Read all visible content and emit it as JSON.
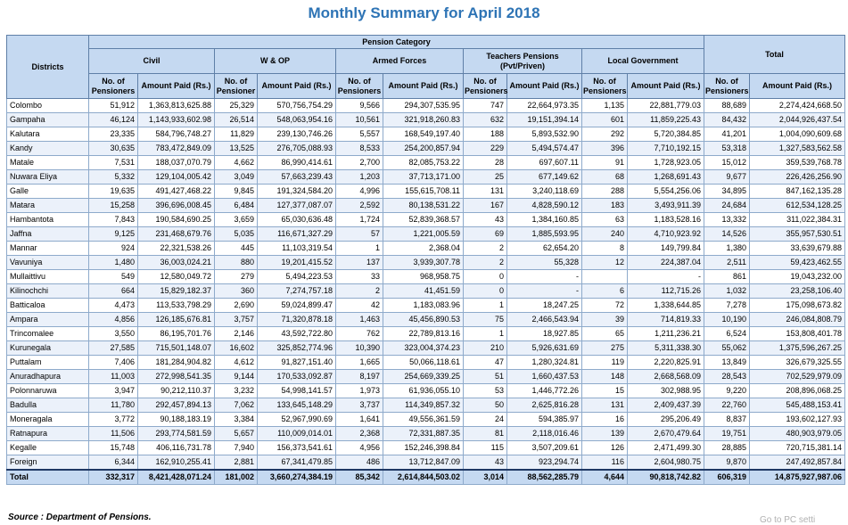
{
  "title": "Monthly Summary for  April 2018",
  "headers": {
    "districts": "Districts",
    "pension_category": "Pension Category",
    "total": "Total",
    "civil": "Civil",
    "wop": "W & OP",
    "armed": "Armed Forces",
    "teachers": "Teachers Pensions (Pvt/Priven)",
    "local": "Local Government",
    "civil_no": "No. of Pensioners",
    "civil_amt": "Amount Paid (Rs.)",
    "wop_no": "No. of Pensioner",
    "wop_amt": "Amount Paid (Rs.)",
    "armed_no": "No. of Pensioners",
    "armed_amt": "Amount Paid (Rs.)",
    "teach_no": "No. of Pensioners",
    "teach_amt": "Amount Paid (Rs.)",
    "local_no": "No. of Pensioners",
    "local_amt": "Amount Paid (Rs.)",
    "total_no": "No. of Pensioners",
    "total_amt": "Amount Paid (Rs.)"
  },
  "rows": [
    [
      "Colombo",
      "51,912",
      "1,363,813,625.88",
      "25,329",
      "570,756,754.29",
      "9,566",
      "294,307,535.95",
      "747",
      "22,664,973.35",
      "1,135",
      "22,881,779.03",
      "88,689",
      "2,274,424,668.50"
    ],
    [
      "Gampaha",
      "46,124",
      "1,143,933,602.98",
      "26,514",
      "548,063,954.16",
      "10,561",
      "321,918,260.83",
      "632",
      "19,151,394.14",
      "601",
      "11,859,225.43",
      "84,432",
      "2,044,926,437.54"
    ],
    [
      "Kalutara",
      "23,335",
      "584,796,748.27",
      "11,829",
      "239,130,746.26",
      "5,557",
      "168,549,197.40",
      "188",
      "5,893,532.90",
      "292",
      "5,720,384.85",
      "41,201",
      "1,004,090,609.68"
    ],
    [
      "Kandy",
      "30,635",
      "783,472,849.09",
      "13,525",
      "276,705,088.93",
      "8,533",
      "254,200,857.94",
      "229",
      "5,494,574.47",
      "396",
      "7,710,192.15",
      "53,318",
      "1,327,583,562.58"
    ],
    [
      "Matale",
      "7,531",
      "188,037,070.79",
      "4,662",
      "86,990,414.61",
      "2,700",
      "82,085,753.22",
      "28",
      "697,607.11",
      "91",
      "1,728,923.05",
      "15,012",
      "359,539,768.78"
    ],
    [
      "Nuwara Eliya",
      "5,332",
      "129,104,005.42",
      "3,049",
      "57,663,239.43",
      "1,203",
      "37,713,171.00",
      "25",
      "677,149.62",
      "68",
      "1,268,691.43",
      "9,677",
      "226,426,256.90"
    ],
    [
      "Galle",
      "19,635",
      "491,427,468.22",
      "9,845",
      "191,324,584.20",
      "4,996",
      "155,615,708.11",
      "131",
      "3,240,118.69",
      "288",
      "5,554,256.06",
      "34,895",
      "847,162,135.28"
    ],
    [
      "Matara",
      "15,258",
      "396,696,008.45",
      "6,484",
      "127,377,087.07",
      "2,592",
      "80,138,531.22",
      "167",
      "4,828,590.12",
      "183",
      "3,493,911.39",
      "24,684",
      "612,534,128.25"
    ],
    [
      "Hambantota",
      "7,843",
      "190,584,690.25",
      "3,659",
      "65,030,636.48",
      "1,724",
      "52,839,368.57",
      "43",
      "1,384,160.85",
      "63",
      "1,183,528.16",
      "13,332",
      "311,022,384.31"
    ],
    [
      "Jaffna",
      "9,125",
      "231,468,679.76",
      "5,035",
      "116,671,327.29",
      "57",
      "1,221,005.59",
      "69",
      "1,885,593.95",
      "240",
      "4,710,923.92",
      "14,526",
      "355,957,530.51"
    ],
    [
      "Mannar",
      "924",
      "22,321,538.26",
      "445",
      "11,103,319.54",
      "1",
      "2,368.04",
      "2",
      "62,654.20",
      "8",
      "149,799.84",
      "1,380",
      "33,639,679.88"
    ],
    [
      "Vavuniya",
      "1,480",
      "36,003,024.21",
      "880",
      "19,201,415.52",
      "137",
      "3,939,307.78",
      "2",
      "55,328",
      "12",
      "224,387.04",
      "2,511",
      "59,423,462.55"
    ],
    [
      "Mullaittivu",
      "549",
      "12,580,049.72",
      "279",
      "5,494,223.53",
      "33",
      "968,958.75",
      "0",
      "-",
      "",
      "-",
      "861",
      "19,043,232.00"
    ],
    [
      "Kilinochchi",
      "664",
      "15,829,182.37",
      "360",
      "7,274,757.18",
      "2",
      "41,451.59",
      "0",
      "-",
      "6",
      "112,715.26",
      "1,032",
      "23,258,106.40"
    ],
    [
      "Batticaloa",
      "4,473",
      "113,533,798.29",
      "2,690",
      "59,024,899.47",
      "42",
      "1,183,083.96",
      "1",
      "18,247.25",
      "72",
      "1,338,644.85",
      "7,278",
      "175,098,673.82"
    ],
    [
      "Ampara",
      "4,856",
      "126,185,676.81",
      "3,757",
      "71,320,878.18",
      "1,463",
      "45,456,890.53",
      "75",
      "2,466,543.94",
      "39",
      "714,819.33",
      "10,190",
      "246,084,808.79"
    ],
    [
      "Trincomalee",
      "3,550",
      "86,195,701.76",
      "2,146",
      "43,592,722.80",
      "762",
      "22,789,813.16",
      "1",
      "18,927.85",
      "65",
      "1,211,236.21",
      "6,524",
      "153,808,401.78"
    ],
    [
      "Kurunegala",
      "27,585",
      "715,501,148.07",
      "16,602",
      "325,852,774.96",
      "10,390",
      "323,004,374.23",
      "210",
      "5,926,631.69",
      "275",
      "5,311,338.30",
      "55,062",
      "1,375,596,267.25"
    ],
    [
      "Puttalam",
      "7,406",
      "181,284,904.82",
      "4,612",
      "91,827,151.40",
      "1,665",
      "50,066,118.61",
      "47",
      "1,280,324.81",
      "119",
      "2,220,825.91",
      "13,849",
      "326,679,325.55"
    ],
    [
      "Anuradhapura",
      "11,003",
      "272,998,541.35",
      "9,144",
      "170,533,092.87",
      "8,197",
      "254,669,339.25",
      "51",
      "1,660,437.53",
      "148",
      "2,668,568.09",
      "28,543",
      "702,529,979.09"
    ],
    [
      "Polonnaruwa",
      "3,947",
      "90,212,110.37",
      "3,232",
      "54,998,141.57",
      "1,973",
      "61,936,055.10",
      "53",
      "1,446,772.26",
      "15",
      "302,988.95",
      "9,220",
      "208,896,068.25"
    ],
    [
      "Badulla",
      "11,780",
      "292,457,894.13",
      "7,062",
      "133,645,148.29",
      "3,737",
      "114,349,857.32",
      "50",
      "2,625,816.28",
      "131",
      "2,409,437.39",
      "22,760",
      "545,488,153.41"
    ],
    [
      "Moneragala",
      "3,772",
      "90,188,183.19",
      "3,384",
      "52,967,990.69",
      "1,641",
      "49,556,361.59",
      "24",
      "594,385.97",
      "16",
      "295,206.49",
      "8,837",
      "193,602,127.93"
    ],
    [
      "Ratnapura",
      "11,506",
      "293,774,581.59",
      "5,657",
      "110,009,014.01",
      "2,368",
      "72,331,887.35",
      "81",
      "2,118,016.46",
      "139",
      "2,670,479.64",
      "19,751",
      "480,903,979.05"
    ],
    [
      "Kegalle",
      "15,748",
      "406,116,731.78",
      "7,940",
      "156,373,541.61",
      "4,956",
      "152,246,398.84",
      "115",
      "3,507,209.61",
      "126",
      "2,471,499.30",
      "28,885",
      "720,715,381.14"
    ],
    [
      "Foreign",
      "6,344",
      "162,910,255.41",
      "2,881",
      "67,341,479.85",
      "486",
      "13,712,847.09",
      "43",
      "923,294.74",
      "116",
      "2,604,980.75",
      "9,870",
      "247,492,857.84"
    ]
  ],
  "total_row": [
    "Total",
    "332,317",
    "8,421,428,071.24",
    "181,002",
    "3,660,274,384.19",
    "85,342",
    "2,614,844,503.02",
    "3,014",
    "88,562,285.79",
    "4,644",
    "90,818,742.82",
    "606,319",
    "14,875,927,987.06"
  ],
  "source": "Source : Department of Pensions.",
  "overlay_text": "Go to PC setti"
}
